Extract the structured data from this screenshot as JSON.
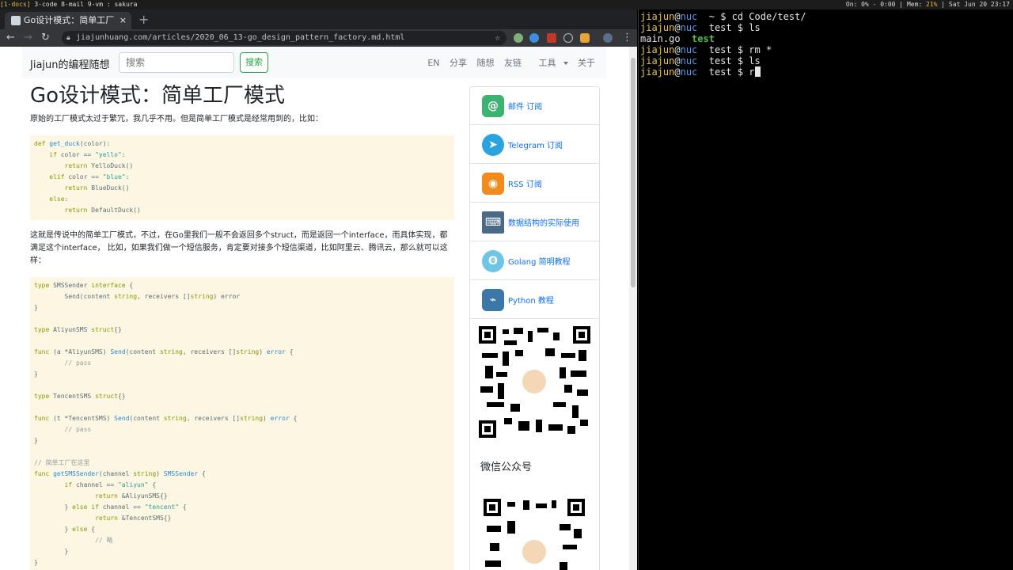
{
  "statusbar": {
    "workspace_active": "[1-docs]",
    "workspaces_rest": " 3-code  8-mail  9-vm : sakura",
    "right_prefix": "On: 0% - 0:00 | Mem: ",
    "mem_value": "21%",
    "right_suffix": " | Sat Jun 20 23:17"
  },
  "browser": {
    "tab_title": "Go设计模式：简单工厂",
    "tab_close": "×",
    "new_tab": "+",
    "url": "jiajunhuang.com/articles/2020_06_13-go_design_pattern_factory.md.html",
    "nav": {
      "back": "←",
      "forward": "→",
      "reload": "↻"
    },
    "star": "☆",
    "menu": "⋮"
  },
  "site": {
    "brand": "Jiajun的编程随想",
    "search_placeholder": "搜索",
    "search_button": "搜索",
    "nav_links": [
      "EN",
      "分享",
      "随想",
      "友链",
      "工具",
      "关于"
    ]
  },
  "article": {
    "title": "Go设计模式：简单工厂模式",
    "intro": "原始的工厂模式太过于繁冗，我几乎不用。但是简单工厂模式是经常用到的，比如：",
    "para2": "这就是传说中的简单工厂模式，不过，在Go里我们一般不会返回多个struct，而是返回一个interface，而具体实现，都满足这个interface， 比如，如果我们做一个短信服务，肯定要对接多个短信渠道，比如阿里云、腾讯云，那么就可以这样："
  },
  "sidebar": {
    "items": [
      {
        "label": "邮件 订阅",
        "icon": "at-icon",
        "color": "#3cb371"
      },
      {
        "label": "Telegram 订阅",
        "icon": "telegram-icon",
        "color": "#2aa3de"
      },
      {
        "label": "RSS 订阅",
        "icon": "rss-icon",
        "color": "#f28b1c"
      },
      {
        "label": "数据结构的实际使用",
        "icon": "laptop-icon",
        "color": "#4a6a8a"
      },
      {
        "label": "Golang 简明教程",
        "icon": "gopher-icon",
        "color": "#6ec6e6"
      },
      {
        "label": "Python 教程",
        "icon": "python-icon",
        "color": "#3b77a8"
      }
    ],
    "wechat_label": "微信公众号"
  },
  "terminal": {
    "lines": [
      {
        "user": "jiajun",
        "at": "@",
        "host": "nuc",
        "dir": "  ~ ",
        "cmd": "$ cd Code/test/"
      },
      {
        "user": "jiajun",
        "at": "@",
        "host": "nuc",
        "dir": "  test ",
        "cmd": "$ ls"
      },
      {
        "output_plain": "main.go  ",
        "output_dir": "test"
      },
      {
        "user": "jiajun",
        "at": "@",
        "host": "nuc",
        "dir": "  test ",
        "cmd": "$ rm *"
      },
      {
        "user": "jiajun",
        "at": "@",
        "host": "nuc",
        "dir": "  test ",
        "cmd": "$ ls"
      },
      {
        "user": "jiajun",
        "at": "@",
        "host": "nuc",
        "dir": "  test ",
        "cmd": "$ r"
      }
    ]
  }
}
